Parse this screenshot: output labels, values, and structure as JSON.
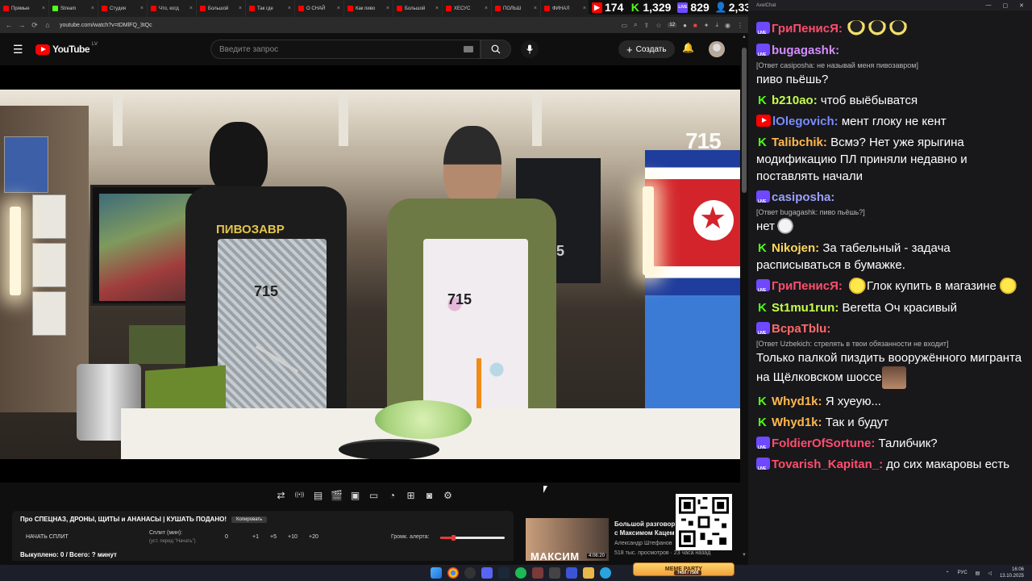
{
  "browser": {
    "tabs": [
      {
        "label": "Прямые",
        "color": "#ff0000"
      },
      {
        "label": "Stream",
        "color": "#53fc18"
      },
      {
        "label": "Студия",
        "color": "#ff0000"
      },
      {
        "label": "Что, когд",
        "color": "#ff0000"
      },
      {
        "label": "Большой",
        "color": "#ff0000"
      },
      {
        "label": "Так где",
        "color": "#ff0000"
      },
      {
        "label": "О СНАЙ",
        "color": "#ff0000"
      },
      {
        "label": "Как пиво",
        "color": "#ff0000"
      },
      {
        "label": "Большой",
        "color": "#ff0000"
      },
      {
        "label": "ХЕСУС",
        "color": "#ff0000"
      },
      {
        "label": "ПОЛЬШ",
        "color": "#ff0000"
      },
      {
        "label": "ФИНАЛ",
        "color": "#ff0000"
      }
    ],
    "url": "youtube.com/watch?v=tDMlFQ_3tQc",
    "ext_count": "12"
  },
  "stream_stats": {
    "youtube": "174",
    "kick": "1,329",
    "vk": "829",
    "total": "2,332"
  },
  "youtube": {
    "logo_text": "YouTube",
    "country": "LV",
    "search_placeholder": "Введите запрос",
    "create_label": "Создать"
  },
  "video": {
    "watermark": "715",
    "apron_text_1": "715",
    "apron_text_2": "715",
    "shirt_text": "ПИВОЗАВР",
    "banner_text": "715"
  },
  "player_controls": [
    "loop-icon",
    "live-icon",
    "subtitles-icon",
    "clapper-icon",
    "miniplayer-icon",
    "theater-icon",
    "speed-icon",
    "plus-box-icon",
    "screenshot-icon",
    "settings-icon"
  ],
  "split": {
    "title": "Про СПЕЦНАЗ, ДРОНЫ, ЩИТЫ и АНАНАСЫ | КУШАТЬ ПОДАНО!",
    "copy_label": "Копировать",
    "start_label": "НАЧАТЬ СПЛИТ",
    "minutes_label": "Сплит (мин):",
    "minutes_hint": "(уст. перед \"Начать\")",
    "value": "0",
    "increments": [
      "+1",
      "+5",
      "+10",
      "+20"
    ],
    "volume_label": "Громк. алерта:",
    "volume_fraction": 0.2,
    "bought": "Выкуплено: 0 / Всего: ? минут"
  },
  "recommendation": {
    "thumb_text": "МАКСИМ",
    "duration": "4:06:20",
    "title": "Большой разговор с Максимом Кацем",
    "channel": "Александр Штефанов",
    "meta": "518 тыс. просмотров · 23 часа назад"
  },
  "chat": {
    "window_title": "AxelChat",
    "messages": [
      {
        "platform": "vk",
        "nick": "ГриПенисЯ:",
        "color": "#ff4d6d",
        "text": "",
        "emotes": [
          "pingu",
          "pingu",
          "pingu"
        ]
      },
      {
        "platform": "vk",
        "nick": "bugagashk:",
        "color": "#d48cff",
        "reply": "[Ответ casiposha: не называй меня пивозавром]",
        "text": "пиво пьёшь?"
      },
      {
        "platform": "kick",
        "nick": "b210ao:",
        "color": "#c7ff4a",
        "text": "чтоб выёбыватся"
      },
      {
        "platform": "yt",
        "nick": "lOlegovich:",
        "color": "#7a8cff",
        "text": "мент глоку не кент"
      },
      {
        "platform": "kick",
        "nick": "Talibchik:",
        "color": "#ffb84d",
        "text": "Всмэ? Нет уже ярыгина модификацию ПЛ приняли недавно и поставлять начали"
      },
      {
        "platform": "vk",
        "nick": "casiposha:",
        "color": "#9aa0ff",
        "reply": "[Ответ bugagashk: пиво пьёшь?]",
        "text": "нет",
        "emotes_after": [
          "face"
        ]
      },
      {
        "platform": "kick",
        "nick": "Nikojen:",
        "color": "#ffd95a",
        "text": "За табельный - задача расписываться в бумажке."
      },
      {
        "platform": "vk",
        "nick": "ГриПенисЯ:",
        "color": "#ff4d6d",
        "text": "Глок купить в магазине",
        "emotes_mid": [
          "duck",
          "duck"
        ]
      },
      {
        "platform": "kick",
        "nick": "St1mu1run:",
        "color": "#c7ff4a",
        "text": "Beretta Оч красивый"
      },
      {
        "platform": "vk",
        "nick": "BcpaTblu:",
        "color": "#ff6b6b",
        "reply": "[Ответ Uzbekich: стрелять в твои обязанности не входит]",
        "text": "Только палкой пиздить вооружённого мигранта на Щёлковском шоссе",
        "emotes_after": [
          "man"
        ]
      },
      {
        "platform": "kick",
        "nick": "Whyd1k:",
        "color": "#ffb84d",
        "text": "Я хуеую..."
      },
      {
        "platform": "kick",
        "nick": "Whyd1k:",
        "color": "#ffb84d",
        "text": "Так и будут"
      },
      {
        "platform": "vk",
        "nick": "FoldierOfSortune:",
        "color": "#ff4d6d",
        "text": "Талибчик?"
      },
      {
        "platform": "vk",
        "nick": "Tovarish_Kapitan_:",
        "color": "#ff4d6d",
        "text": "до сих макаровы есть"
      }
    ]
  },
  "taskbar": {
    "game_label": "MEME PARTY",
    "game_sub": "7450 / 7500",
    "lang": "РУС",
    "time": "16:06",
    "date": "13.10.2025"
  }
}
